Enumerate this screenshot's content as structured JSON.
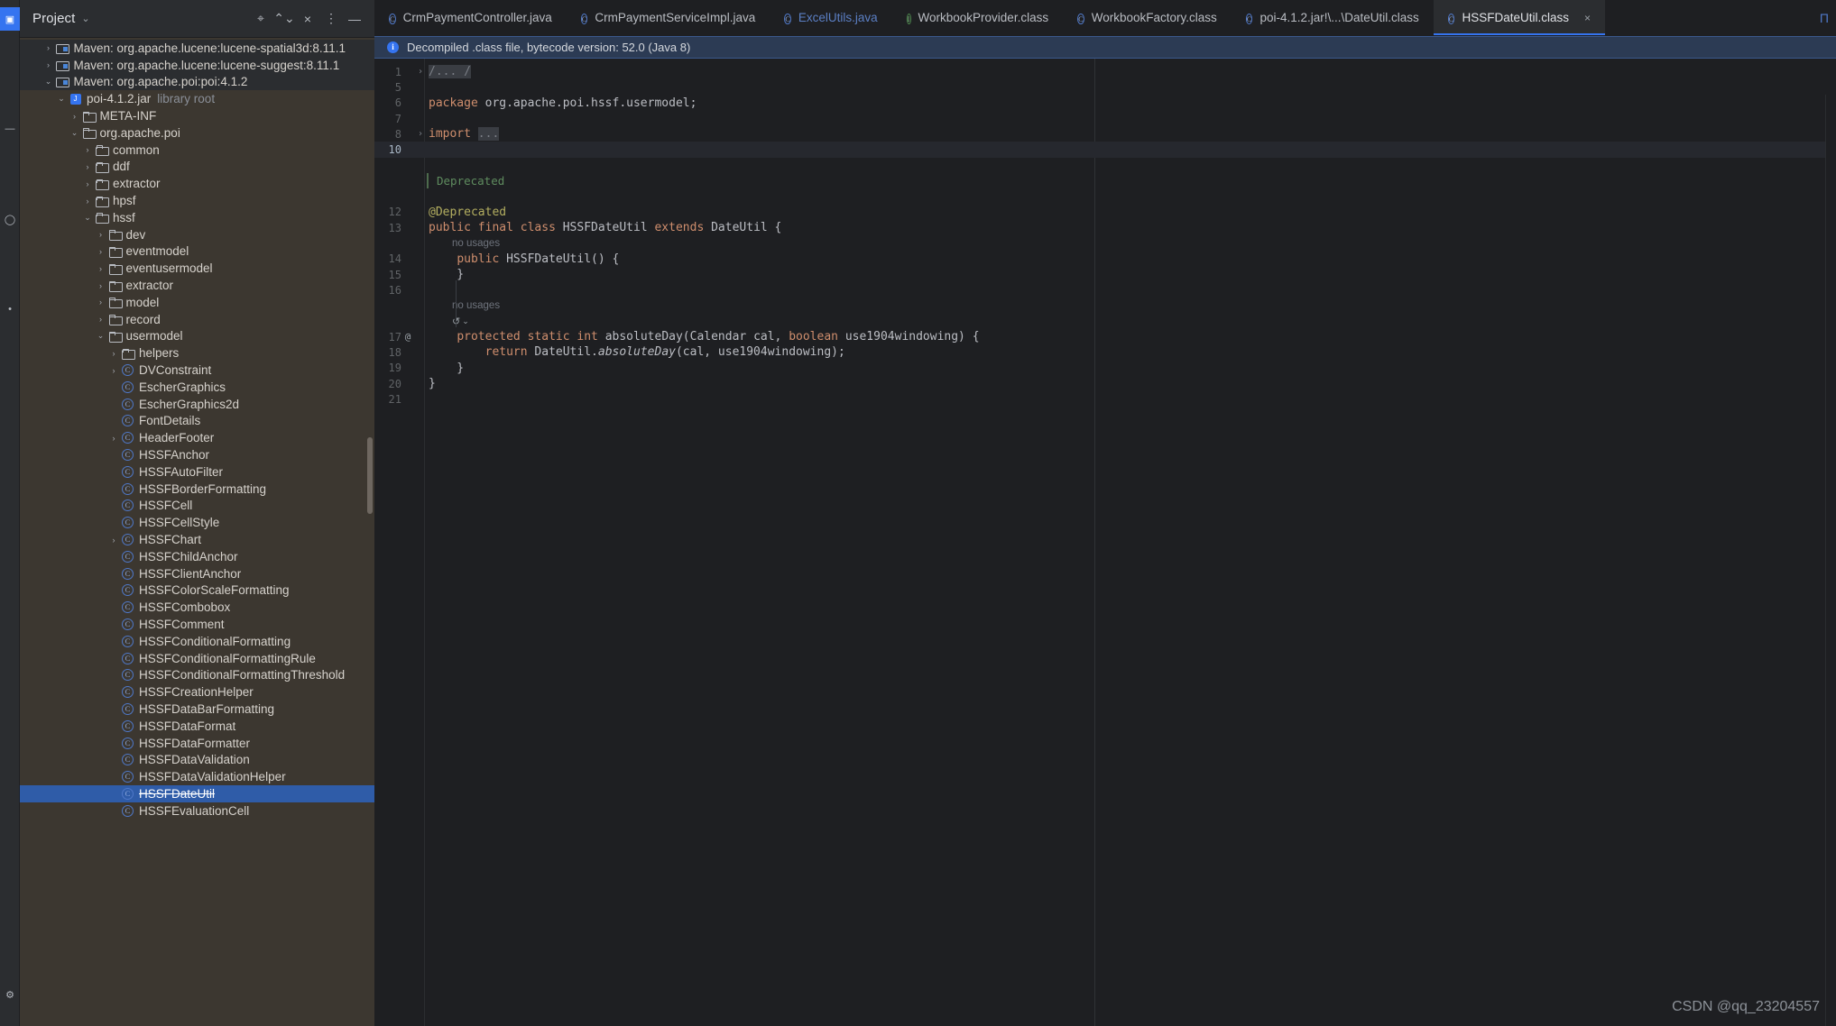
{
  "activity_bar": {
    "items": [
      {
        "name": "project-tool-icon",
        "glyph": "▣",
        "active": true
      },
      {
        "name": "structure-tool-icon",
        "glyph": "≡",
        "active": false
      },
      {
        "name": "commit-tool-icon",
        "glyph": "○",
        "active": false
      },
      {
        "name": "bookmarks-tool-icon",
        "glyph": "★",
        "active": false
      },
      {
        "name": "build-tool-icon",
        "glyph": "⚒",
        "active": false
      }
    ]
  },
  "project_panel": {
    "title": "Project",
    "dropdown_glyph": "⌄",
    "toolbar_icons": [
      {
        "name": "locate-file-icon",
        "glyph": "⌖"
      },
      {
        "name": "expand-collapse-icon",
        "glyph": "⌃⌄"
      },
      {
        "name": "collapse-all-icon",
        "glyph": "×"
      },
      {
        "name": "options-menu-icon",
        "glyph": "⋮"
      },
      {
        "name": "hide-panel-icon",
        "glyph": "—"
      }
    ],
    "tree": [
      {
        "label": "Maven: org.apache.lucene:lucene-spatial3d:8.11.1",
        "icon": "maven",
        "indent": 1,
        "twisty": "collapsed",
        "dark": true
      },
      {
        "label": "Maven: org.apache.lucene:lucene-suggest:8.11.1",
        "icon": "maven",
        "indent": 1,
        "twisty": "collapsed",
        "dark": true
      },
      {
        "label": "Maven: org.apache.poi:poi:4.1.2",
        "icon": "maven",
        "indent": 1,
        "twisty": "expanded",
        "dark": true
      },
      {
        "label": "poi-4.1.2.jar",
        "sublabel": "library root",
        "icon": "jar",
        "indent": 2,
        "twisty": "expanded"
      },
      {
        "label": "META-INF",
        "icon": "folder",
        "indent": 3,
        "twisty": "collapsed"
      },
      {
        "label": "org.apache.poi",
        "icon": "folder",
        "indent": 3,
        "twisty": "expanded"
      },
      {
        "label": "common",
        "icon": "folder",
        "indent": 4,
        "twisty": "collapsed"
      },
      {
        "label": "ddf",
        "icon": "folder",
        "indent": 4,
        "twisty": "collapsed"
      },
      {
        "label": "extractor",
        "icon": "folder",
        "indent": 4,
        "twisty": "collapsed"
      },
      {
        "label": "hpsf",
        "icon": "folder",
        "indent": 4,
        "twisty": "collapsed"
      },
      {
        "label": "hssf",
        "icon": "folder",
        "indent": 4,
        "twisty": "expanded"
      },
      {
        "label": "dev",
        "icon": "folder",
        "indent": 5,
        "twisty": "collapsed"
      },
      {
        "label": "eventmodel",
        "icon": "folder",
        "indent": 5,
        "twisty": "collapsed"
      },
      {
        "label": "eventusermodel",
        "icon": "folder",
        "indent": 5,
        "twisty": "collapsed"
      },
      {
        "label": "extractor",
        "icon": "folder",
        "indent": 5,
        "twisty": "collapsed"
      },
      {
        "label": "model",
        "icon": "folder",
        "indent": 5,
        "twisty": "collapsed"
      },
      {
        "label": "record",
        "icon": "folder",
        "indent": 5,
        "twisty": "collapsed"
      },
      {
        "label": "usermodel",
        "icon": "folder",
        "indent": 5,
        "twisty": "expanded"
      },
      {
        "label": "helpers",
        "icon": "folder",
        "indent": 6,
        "twisty": "collapsed"
      },
      {
        "label": "DVConstraint",
        "icon": "class",
        "indent": 6,
        "twisty": "collapsed"
      },
      {
        "label": "EscherGraphics",
        "icon": "class",
        "indent": 6,
        "twisty": "none"
      },
      {
        "label": "EscherGraphics2d",
        "icon": "class",
        "indent": 6,
        "twisty": "none"
      },
      {
        "label": "FontDetails",
        "icon": "class",
        "indent": 6,
        "twisty": "none"
      },
      {
        "label": "HeaderFooter",
        "icon": "class",
        "indent": 6,
        "twisty": "collapsed"
      },
      {
        "label": "HSSFAnchor",
        "icon": "class",
        "indent": 6,
        "twisty": "none"
      },
      {
        "label": "HSSFAutoFilter",
        "icon": "class",
        "indent": 6,
        "twisty": "none"
      },
      {
        "label": "HSSFBorderFormatting",
        "icon": "class",
        "indent": 6,
        "twisty": "none"
      },
      {
        "label": "HSSFCell",
        "icon": "class",
        "indent": 6,
        "twisty": "none"
      },
      {
        "label": "HSSFCellStyle",
        "icon": "class",
        "indent": 6,
        "twisty": "none"
      },
      {
        "label": "HSSFChart",
        "icon": "class",
        "indent": 6,
        "twisty": "collapsed"
      },
      {
        "label": "HSSFChildAnchor",
        "icon": "class",
        "indent": 6,
        "twisty": "none"
      },
      {
        "label": "HSSFClientAnchor",
        "icon": "class",
        "indent": 6,
        "twisty": "none"
      },
      {
        "label": "HSSFColorScaleFormatting",
        "icon": "class",
        "indent": 6,
        "twisty": "none"
      },
      {
        "label": "HSSFCombobox",
        "icon": "class",
        "indent": 6,
        "twisty": "none"
      },
      {
        "label": "HSSFComment",
        "icon": "class",
        "indent": 6,
        "twisty": "none"
      },
      {
        "label": "HSSFConditionalFormatting",
        "icon": "class",
        "indent": 6,
        "twisty": "none"
      },
      {
        "label": "HSSFConditionalFormattingRule",
        "icon": "class",
        "indent": 6,
        "twisty": "none"
      },
      {
        "label": "HSSFConditionalFormattingThreshold",
        "icon": "class",
        "indent": 6,
        "twisty": "none"
      },
      {
        "label": "HSSFCreationHelper",
        "icon": "class",
        "indent": 6,
        "twisty": "none"
      },
      {
        "label": "HSSFDataBarFormatting",
        "icon": "class",
        "indent": 6,
        "twisty": "none"
      },
      {
        "label": "HSSFDataFormat",
        "icon": "class",
        "indent": 6,
        "twisty": "none"
      },
      {
        "label": "HSSFDataFormatter",
        "icon": "class",
        "indent": 6,
        "twisty": "none"
      },
      {
        "label": "HSSFDataValidation",
        "icon": "class",
        "indent": 6,
        "twisty": "none"
      },
      {
        "label": "HSSFDataValidationHelper",
        "icon": "class",
        "indent": 6,
        "twisty": "none"
      },
      {
        "label": "HSSFDateUtil",
        "icon": "class",
        "indent": 6,
        "twisty": "none",
        "selected": true,
        "strike": true
      },
      {
        "label": "HSSFEvaluationCell",
        "icon": "class",
        "indent": 6,
        "twisty": "none"
      }
    ]
  },
  "tabs": [
    {
      "label": "CrmPaymentController.java",
      "icon": "class",
      "active": false
    },
    {
      "label": "CrmPaymentServiceImpl.java",
      "icon": "class",
      "active": false
    },
    {
      "label": "ExcelUtils.java",
      "icon": "class",
      "active": false,
      "muted": true
    },
    {
      "label": "WorkbookProvider.class",
      "icon": "interface",
      "active": false
    },
    {
      "label": "WorkbookFactory.class",
      "icon": "class",
      "active": false
    },
    {
      "label": "poi-4.1.2.jar!\\...\\DateUtil.class",
      "icon": "class",
      "active": false
    },
    {
      "label": "HSSFDateUtil.class",
      "icon": "class",
      "active": true,
      "closable": true,
      "close_glyph": "×"
    }
  ],
  "notification": {
    "icon_glyph": "i",
    "text": "Decompiled .class file, bytecode version: 52.0 (Java 8)"
  },
  "editor": {
    "doc_comment": "Deprecated",
    "hints": {
      "no_usages": "no usages"
    },
    "lines": [
      {
        "num": "1",
        "fold": "›",
        "segments": [
          {
            "t": "/... /",
            "c": "cmt-hl"
          }
        ]
      },
      {
        "num": "5",
        "fold": "",
        "segments": []
      },
      {
        "num": "6",
        "fold": "",
        "segments": [
          {
            "t": "package",
            "c": "kw"
          },
          {
            "t": " org.apache.poi.hssf.usermodel;",
            "c": "ident"
          }
        ]
      },
      {
        "num": "7",
        "fold": "",
        "segments": []
      },
      {
        "num": "8",
        "fold": "›",
        "segments": [
          {
            "t": "import",
            "c": "kw"
          },
          {
            "t": " ",
            "c": "ident"
          },
          {
            "t": "...",
            "c": "imp-hl"
          }
        ]
      },
      {
        "num": "10",
        "fold": "",
        "segments": [],
        "current": true
      },
      {
        "num": "12",
        "fold": "",
        "segments": [
          {
            "t": "@Deprecated",
            "c": "anno"
          }
        ]
      },
      {
        "num": "13",
        "fold": "",
        "segments": [
          {
            "t": "public",
            "c": "kw"
          },
          {
            "t": " ",
            "c": "ident"
          },
          {
            "t": "final",
            "c": "kw"
          },
          {
            "t": " ",
            "c": "ident"
          },
          {
            "t": "class",
            "c": "kw"
          },
          {
            "t": " HSSFDateUtil ",
            "c": "type"
          },
          {
            "t": "extends",
            "c": "kw"
          },
          {
            "t": " DateUtil {",
            "c": "type"
          }
        ]
      },
      {
        "num": "14",
        "fold": "",
        "segments": [
          {
            "t": "    ",
            "c": "ident"
          },
          {
            "t": "public",
            "c": "kw"
          },
          {
            "t": " ",
            "c": "ident"
          },
          {
            "t": "HSSFDateUtil",
            "c": "meth"
          },
          {
            "t": "() {",
            "c": "ident"
          }
        ]
      },
      {
        "num": "15",
        "fold": "",
        "segments": [
          {
            "t": "    }",
            "c": "ident"
          }
        ]
      },
      {
        "num": "16",
        "fold": "",
        "segments": []
      },
      {
        "num": "17",
        "fold": "",
        "gutter": "@",
        "segments": [
          {
            "t": "    ",
            "c": "ident"
          },
          {
            "t": "protected",
            "c": "kw"
          },
          {
            "t": " ",
            "c": "ident"
          },
          {
            "t": "static",
            "c": "kw"
          },
          {
            "t": " ",
            "c": "ident"
          },
          {
            "t": "int",
            "c": "kw"
          },
          {
            "t": " ",
            "c": "ident"
          },
          {
            "t": "absoluteDay",
            "c": "meth"
          },
          {
            "t": "(Calendar cal, ",
            "c": "ident"
          },
          {
            "t": "boolean",
            "c": "kw"
          },
          {
            "t": " use1904windowing) {",
            "c": "ident"
          }
        ]
      },
      {
        "num": "18",
        "fold": "",
        "segments": [
          {
            "t": "        ",
            "c": "ident"
          },
          {
            "t": "return",
            "c": "kw"
          },
          {
            "t": " DateUtil.",
            "c": "ident"
          },
          {
            "t": "absoluteDay",
            "c": "methi"
          },
          {
            "t": "(cal, use1904windowing);",
            "c": "ident"
          }
        ]
      },
      {
        "num": "19",
        "fold": "",
        "segments": [
          {
            "t": "    }",
            "c": "ident"
          }
        ]
      },
      {
        "num": "20",
        "fold": "",
        "segments": [
          {
            "t": "}",
            "c": "ident"
          }
        ]
      },
      {
        "num": "21",
        "fold": "",
        "segments": []
      }
    ],
    "override_marker_glyph": "↺"
  },
  "watermark": "CSDN @qq_23204557",
  "colors": {
    "accent": "#3574f0",
    "panel_bg": "#3c3730",
    "editor_bg": "#1e1f22",
    "tab_bg": "#2b2d30",
    "selection": "#2f5ca8",
    "keyword": "#cf8e6d",
    "annotation": "#b3ae60",
    "doc_comment": "#5f8c5f",
    "notice_bg": "#2c3b54"
  }
}
